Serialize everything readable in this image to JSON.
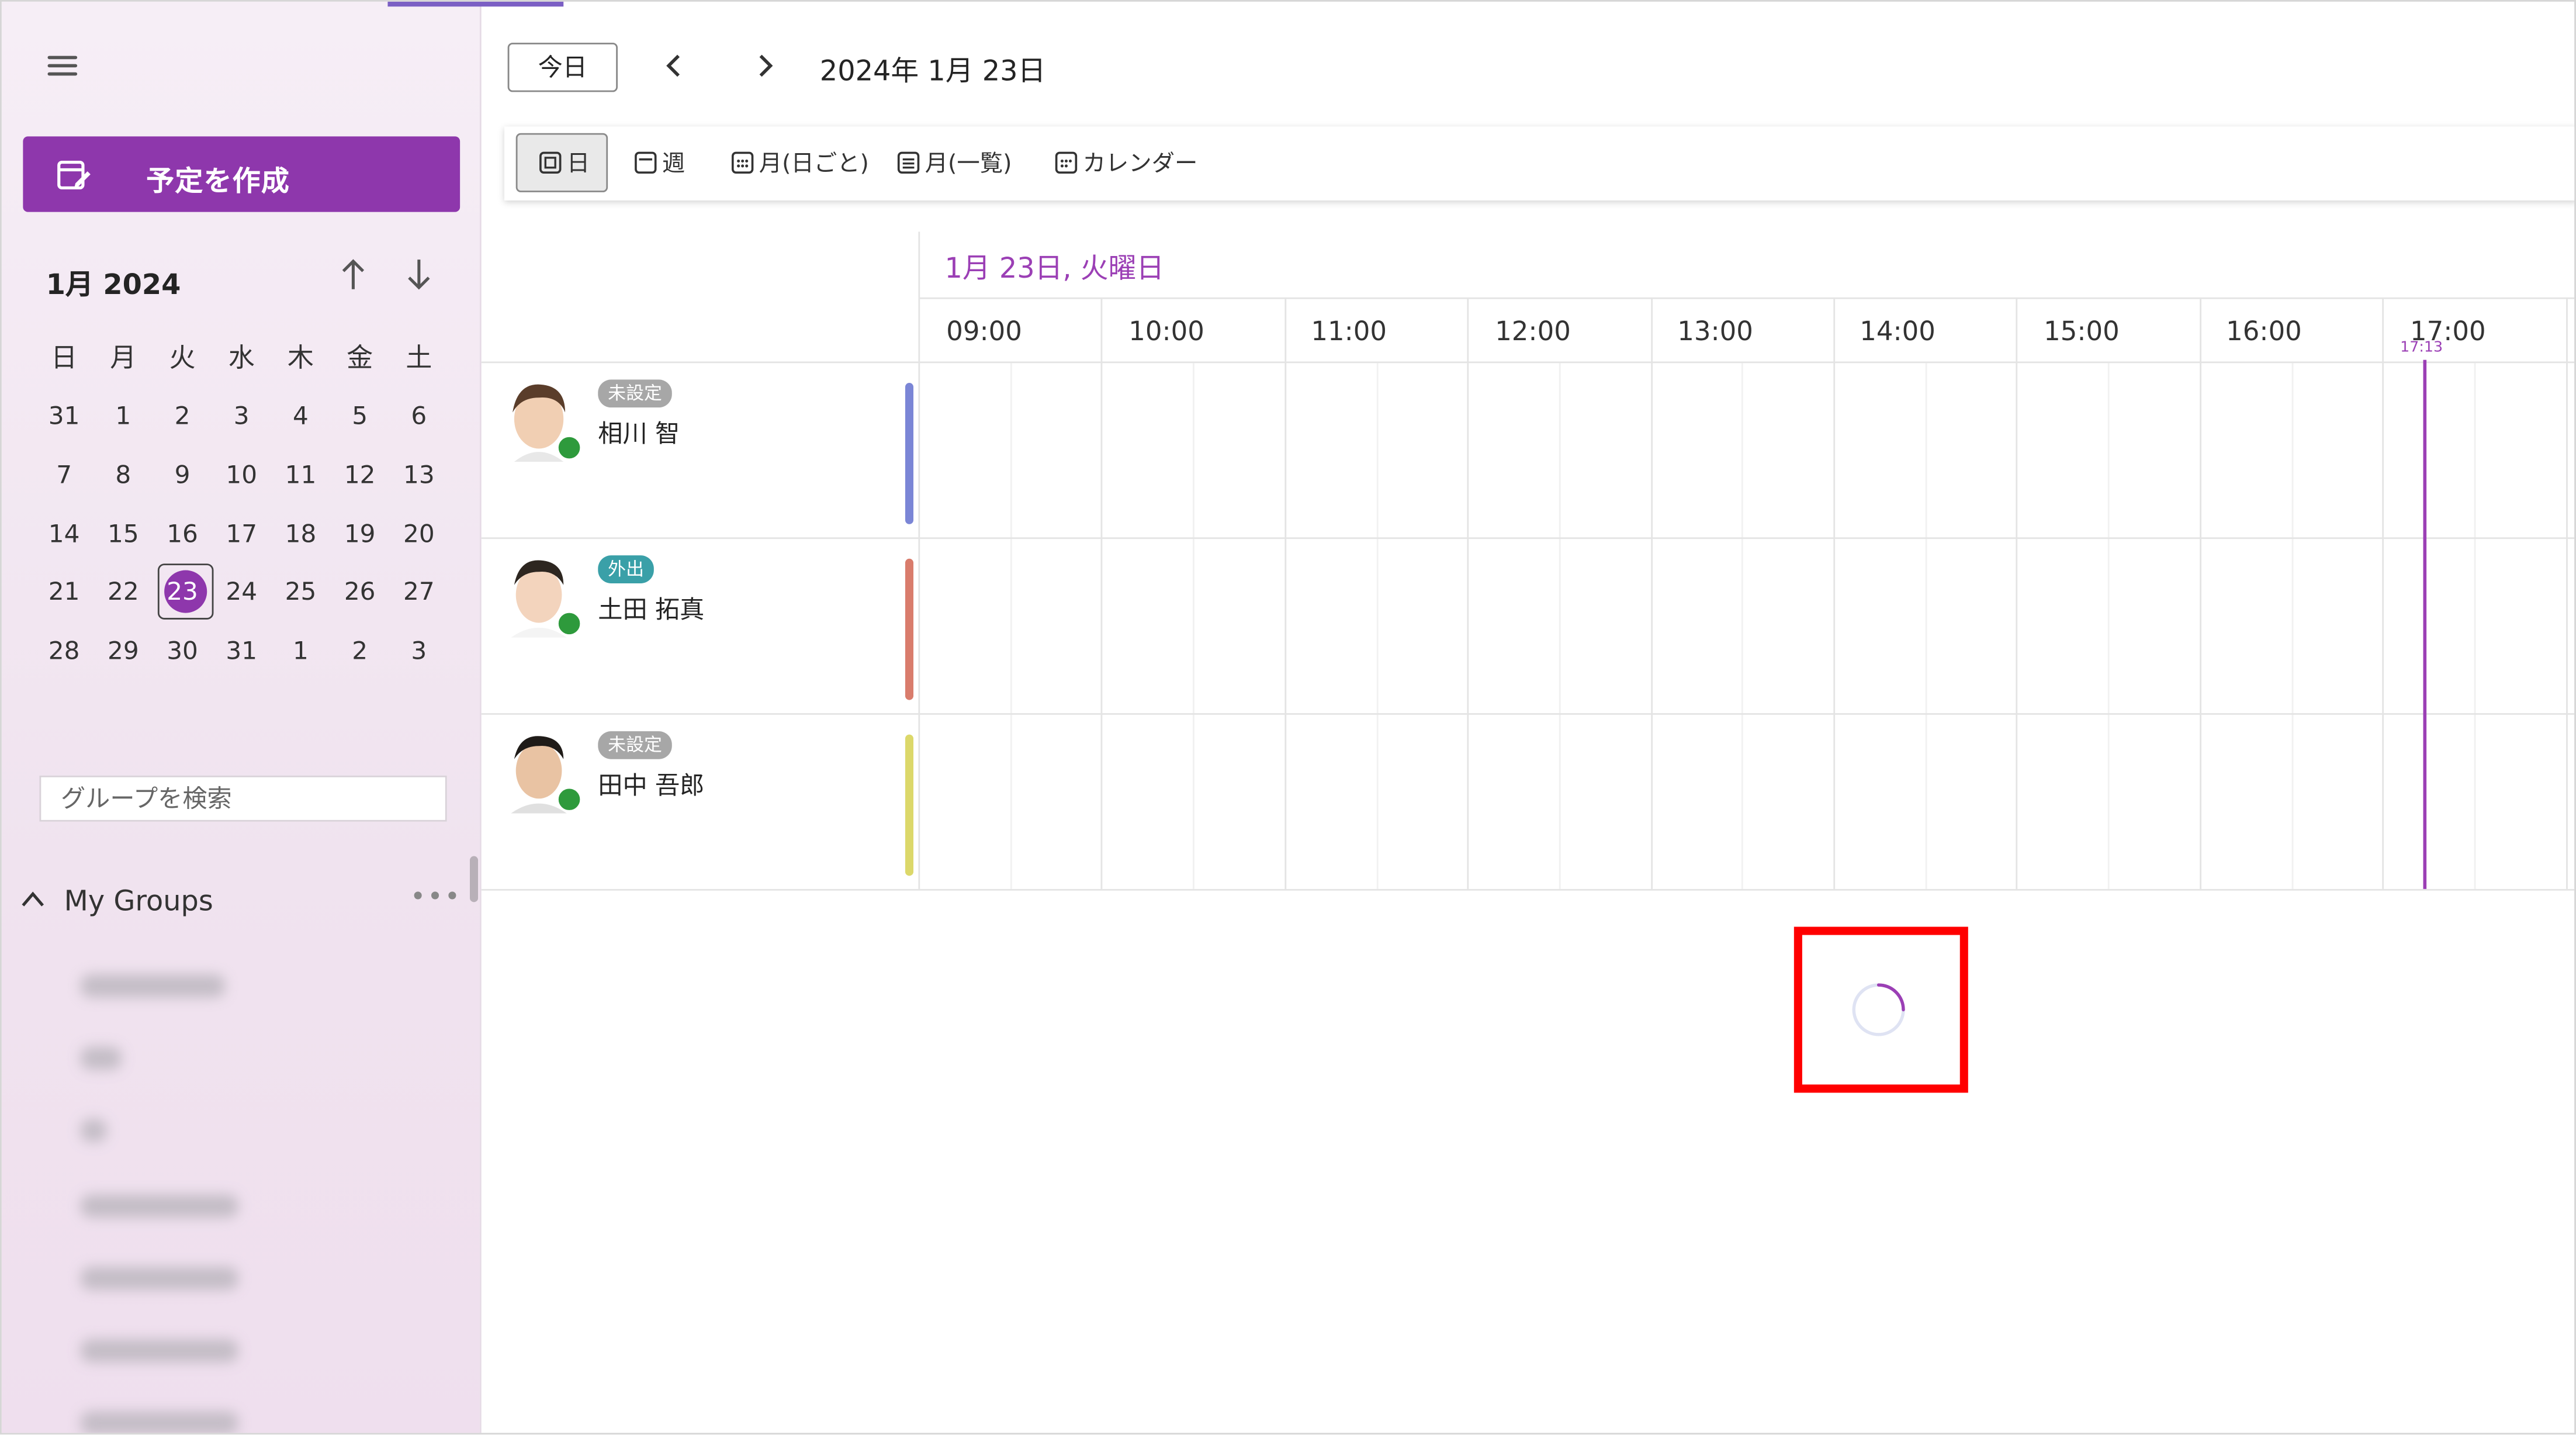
{
  "sidebar": {
    "create_label": "予定を作成",
    "month_label": "1月 2024",
    "weekdays": [
      "日",
      "月",
      "火",
      "水",
      "木",
      "金",
      "土"
    ],
    "weeks": [
      [
        "31",
        "1",
        "2",
        "3",
        "4",
        "5",
        "6"
      ],
      [
        "7",
        "8",
        "9",
        "10",
        "11",
        "12",
        "13"
      ],
      [
        "14",
        "15",
        "16",
        "17",
        "18",
        "19",
        "20"
      ],
      [
        "21",
        "22",
        "23",
        "24",
        "25",
        "26",
        "27"
      ],
      [
        "28",
        "29",
        "30",
        "31",
        "1",
        "2",
        "3"
      ]
    ],
    "selected_day": "23",
    "group_search_placeholder": "グループを検索",
    "groups_title": "My Groups",
    "more_label": "•••"
  },
  "header": {
    "today_label": "今日",
    "date_title": "2024年 1月 23日"
  },
  "views": [
    {
      "label": "日",
      "active": true
    },
    {
      "label": "週",
      "active": false
    },
    {
      "label": "月(日ごと)",
      "active": false
    },
    {
      "label": "月(一覧)",
      "active": false
    },
    {
      "label": "カレンダー",
      "active": false
    }
  ],
  "timeline": {
    "day_label": "1月 23日, 火曜日",
    "hours": [
      "09:00",
      "10:00",
      "11:00",
      "12:00",
      "13:00",
      "14:00",
      "15:00",
      "16:00",
      "17:00"
    ],
    "now_label": "17:13"
  },
  "people": [
    {
      "name": "相川 智",
      "status": "未設定",
      "status_color": "#a7a7a7",
      "bar_color": "#7b86d6"
    },
    {
      "name": "土田 拓真",
      "status": "外出",
      "status_color": "#3aa0a8",
      "bar_color": "#d97c6c"
    },
    {
      "name": "田中 吾郎",
      "status": "未設定",
      "status_color": "#a7a7a7",
      "bar_color": "#dcd86a"
    }
  ],
  "colors": {
    "accent": "#8e37ac",
    "now_line": "#9b3fb5",
    "highlight": "#ff0000"
  }
}
